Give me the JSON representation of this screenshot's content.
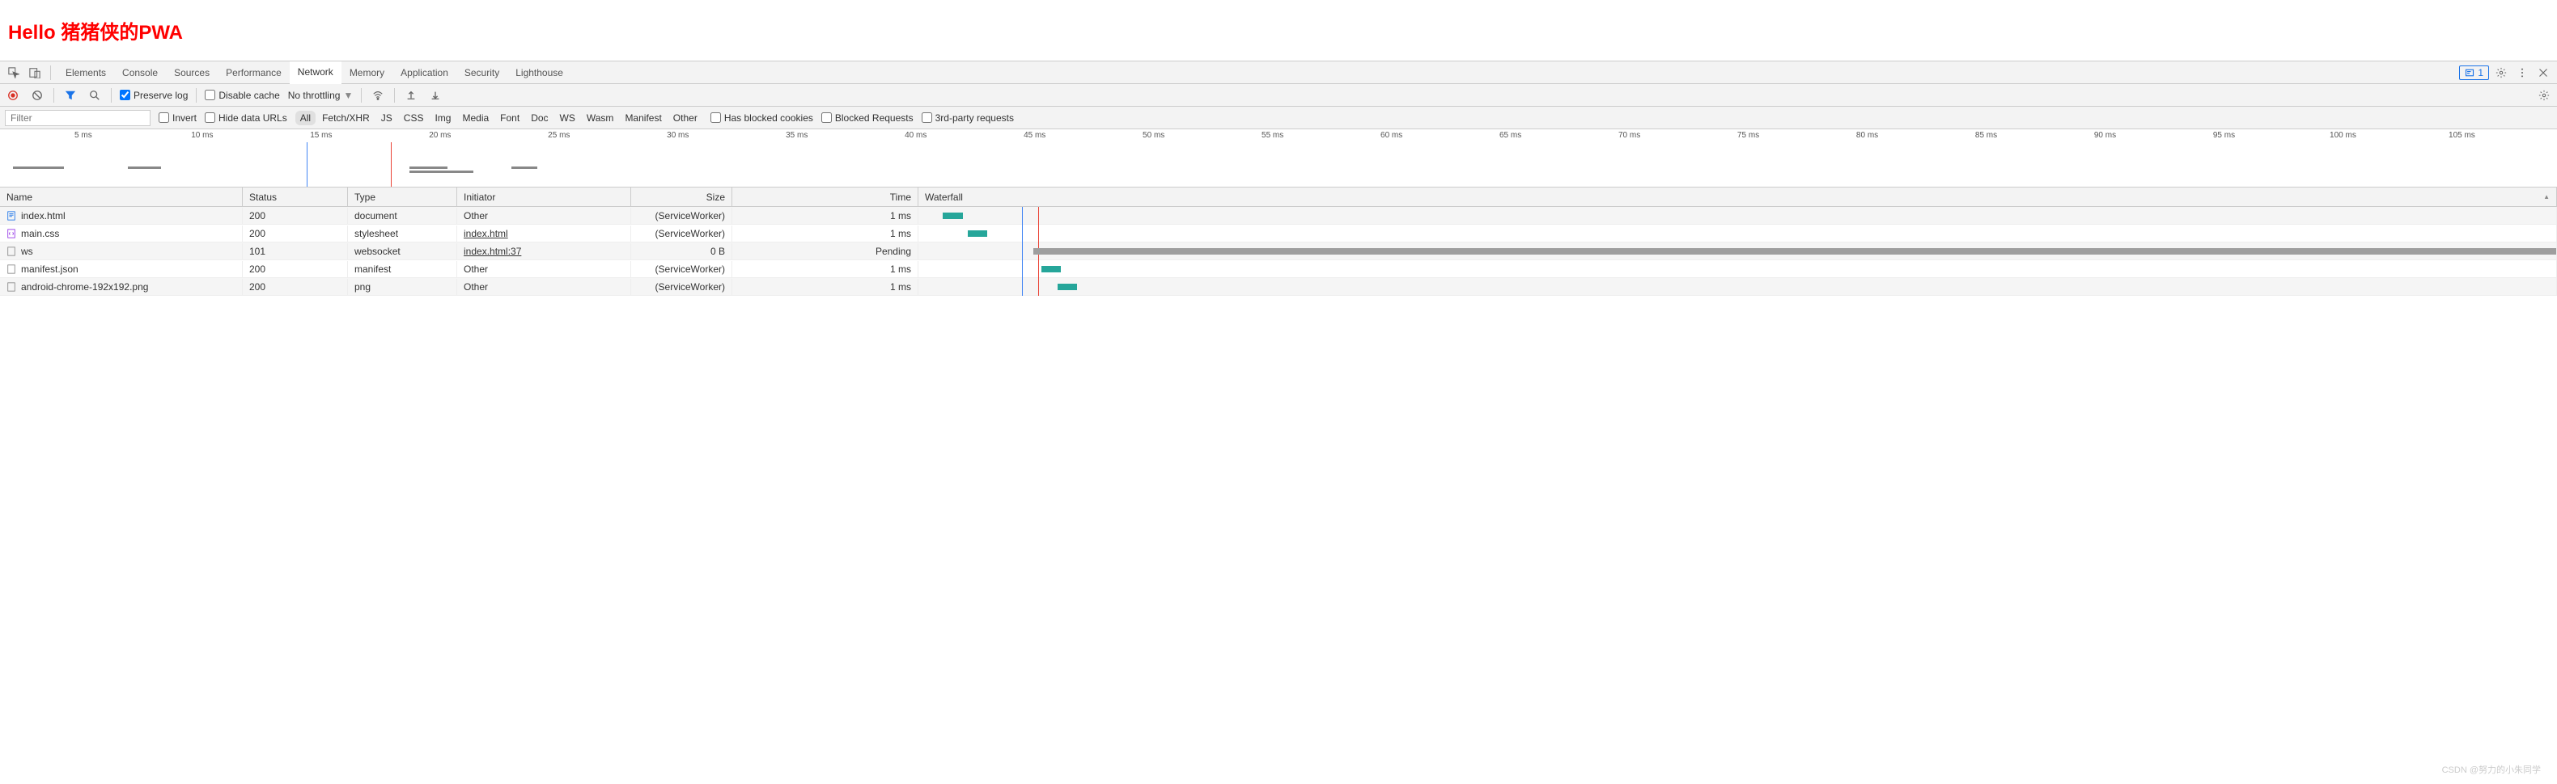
{
  "page": {
    "title": "Hello 猪猪侠的PWA"
  },
  "tabs": {
    "items": [
      "Elements",
      "Console",
      "Sources",
      "Performance",
      "Network",
      "Memory",
      "Application",
      "Security",
      "Lighthouse"
    ],
    "active": "Network",
    "issues_count": "1"
  },
  "toolbar": {
    "preserve_log": "Preserve log",
    "disable_cache": "Disable cache",
    "throttling": "No throttling"
  },
  "filter": {
    "placeholder": "Filter",
    "invert": "Invert",
    "hide_data_urls": "Hide data URLs",
    "types": [
      "All",
      "Fetch/XHR",
      "JS",
      "CSS",
      "Img",
      "Media",
      "Font",
      "Doc",
      "WS",
      "Wasm",
      "Manifest",
      "Other"
    ],
    "active_type": "All",
    "has_blocked": "Has blocked cookies",
    "blocked_requests": "Blocked Requests",
    "third_party": "3rd-party requests"
  },
  "timeline": {
    "ticks": [
      "5 ms",
      "10 ms",
      "15 ms",
      "20 ms",
      "25 ms",
      "30 ms",
      "35 ms",
      "40 ms",
      "45 ms",
      "50 ms",
      "55 ms",
      "60 ms",
      "65 ms",
      "70 ms",
      "75 ms",
      "80 ms",
      "85 ms",
      "90 ms",
      "95 ms",
      "100 ms",
      "105 ms"
    ]
  },
  "columns": {
    "name": "Name",
    "status": "Status",
    "type": "Type",
    "initiator": "Initiator",
    "size": "Size",
    "time": "Time",
    "waterfall": "Waterfall"
  },
  "requests": [
    {
      "name": "index.html",
      "status": "200",
      "type": "document",
      "initiator": "Other",
      "initiator_link": false,
      "size": "(ServiceWorker)",
      "time": "1 ms",
      "icon": "doc",
      "wf_left": 1.5,
      "wf_width": 1.2,
      "wf_color": "teal"
    },
    {
      "name": "main.css",
      "status": "200",
      "type": "stylesheet",
      "initiator": "index.html",
      "initiator_link": true,
      "size": "(ServiceWorker)",
      "time": "1 ms",
      "icon": "css",
      "wf_left": 3.0,
      "wf_width": 1.2,
      "wf_color": "teal"
    },
    {
      "name": "ws",
      "status": "101",
      "type": "websocket",
      "initiator": "index.html:37",
      "initiator_link": true,
      "size": "0 B",
      "time": "Pending",
      "icon": "other",
      "wf_left": 7.0,
      "wf_width": 93,
      "wf_color": "grey"
    },
    {
      "name": "manifest.json",
      "status": "200",
      "type": "manifest",
      "initiator": "Other",
      "initiator_link": false,
      "size": "(ServiceWorker)",
      "time": "1 ms",
      "icon": "other",
      "wf_left": 7.5,
      "wf_width": 1.2,
      "wf_color": "teal"
    },
    {
      "name": "android-chrome-192x192.png",
      "status": "200",
      "type": "png",
      "initiator": "Other",
      "initiator_link": false,
      "size": "(ServiceWorker)",
      "time": "1 ms",
      "icon": "other",
      "wf_left": 8.5,
      "wf_width": 1.2,
      "wf_color": "teal"
    }
  ],
  "waterfall_markers": {
    "blue_pct": 6.3,
    "red_pct": 7.3
  },
  "watermark": "CSDN @努力的小朱同学"
}
